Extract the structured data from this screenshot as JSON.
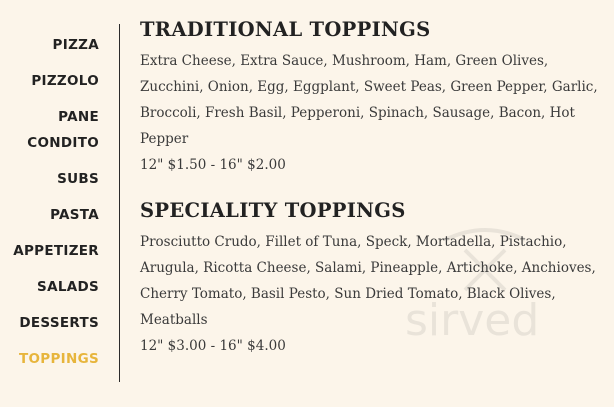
{
  "nav": {
    "items": [
      {
        "label": "PIZZA"
      },
      {
        "label": "PIZZOLO"
      },
      {
        "label": "PANE\nCONDITO"
      },
      {
        "label": "SUBS"
      },
      {
        "label": "PASTA"
      },
      {
        "label": "APPETIZER"
      },
      {
        "label": "SALADS"
      },
      {
        "label": "DESSERTS"
      },
      {
        "label": "TOPPINGS"
      }
    ],
    "active_color": "#e7b53c"
  },
  "sections": [
    {
      "title": "TRADITIONAL TOPPINGS",
      "items": "Extra Cheese, Extra Sauce, Mushroom, Ham, Green Olives, Zucchini, Onion, Egg, Eggplant, Sweet Peas, Green Pepper, Garlic, Broccoli, Fresh Basil, Pepperoni, Spinach, Sausage, Bacon, Hot Pepper",
      "price": "12\" $1.50 - 16\" $2.00"
    },
    {
      "title": "SPECIALITY TOPPINGS",
      "items": "Prosciutto Crudo, Fillet of Tuna, Speck, Mortadella, Pistachio, Arugula, Ricotta Cheese, Salami, Pineapple, Artichoke, Anchioves, Cherry Tomato, Basil Pesto, Sun Dried Tomato, Black Olives, Meatballs",
      "price": "12\" $3.00 - 16\" $4.00"
    }
  ],
  "watermark": {
    "text": "sirved"
  }
}
